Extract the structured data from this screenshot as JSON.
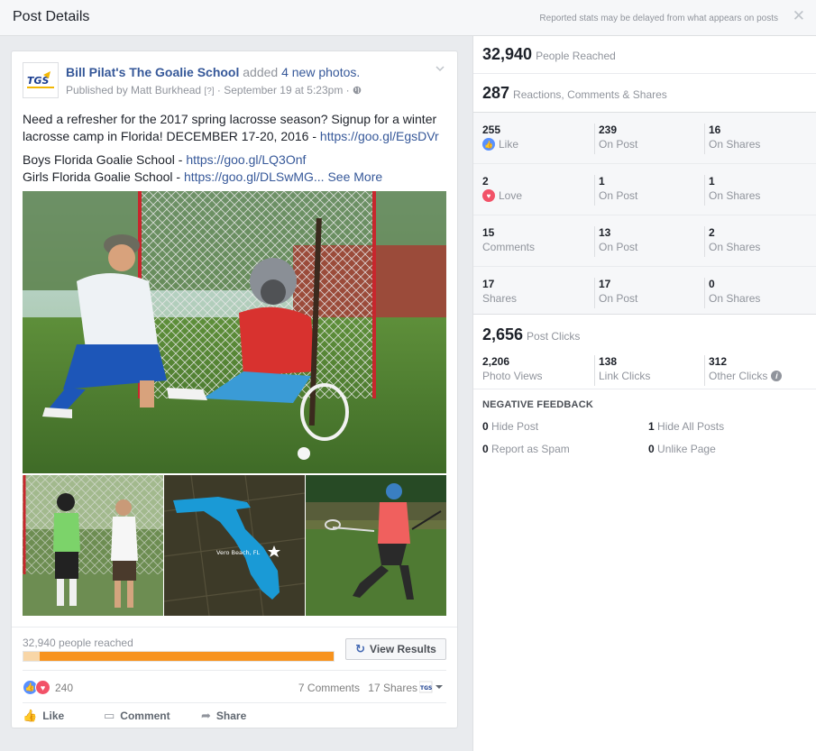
{
  "header": {
    "title": "Post Details",
    "note": "Reported stats may be delayed from what appears on posts",
    "close_icon": "close-icon"
  },
  "post": {
    "page_name": "Bill Pilat's The Goalie School",
    "action_text": "added",
    "photos_text": "4 new photos.",
    "published_by": "Published by Matt Burkhead",
    "help_mark": "[?]",
    "date": "· September 19 at 5:23pm ·",
    "text_line1": "Need a refresher for the 2017 spring lacrosse season? Signup for a winter lacrosse camp in Florida! DECEMBER 17-20, 2016 -",
    "link1": "https://goo.gl/EgsDVr",
    "boys_label": "Boys Florida Goalie School -",
    "boys_link": "https://goo.gl/LQ3Onf",
    "girls_label": "Girls Florida Goalie School -",
    "girls_link": "https://goo.gl/DLSwMG...",
    "see_more": "See More",
    "map_label": "Vero Beach, FL",
    "reach_label": "32,940 people reached",
    "view_results": "View Results",
    "reaction_count": "240",
    "comments": "7 Comments",
    "shares": "17 Shares",
    "like_action": "Like",
    "comment_action": "Comment",
    "share_action": "Share"
  },
  "stats": {
    "people_reached": "32,940",
    "people_reached_label": "People Reached",
    "engagement": "287",
    "engagement_label": "Reactions, Comments & Shares",
    "rows": [
      [
        {
          "num": "255",
          "label": "Like"
        },
        {
          "num": "239",
          "label": "On Post"
        },
        {
          "num": "16",
          "label": "On Shares"
        }
      ],
      [
        {
          "num": "2",
          "label": "Love"
        },
        {
          "num": "1",
          "label": "On Post"
        },
        {
          "num": "1",
          "label": "On Shares"
        }
      ],
      [
        {
          "num": "15",
          "label": "Comments"
        },
        {
          "num": "13",
          "label": "On Post"
        },
        {
          "num": "2",
          "label": "On Shares"
        }
      ],
      [
        {
          "num": "17",
          "label": "Shares"
        },
        {
          "num": "17",
          "label": "On Post"
        },
        {
          "num": "0",
          "label": "On Shares"
        }
      ]
    ],
    "post_clicks": "2,656",
    "post_clicks_label": "Post Clicks",
    "clicks": [
      {
        "num": "2,206",
        "label": "Photo Views"
      },
      {
        "num": "138",
        "label": "Link Clicks"
      },
      {
        "num": "312",
        "label": "Other Clicks"
      }
    ],
    "negative_title": "NEGATIVE FEEDBACK",
    "negative": [
      {
        "num": "0",
        "label": "Hide Post"
      },
      {
        "num": "1",
        "label": "Hide All Posts"
      },
      {
        "num": "0",
        "label": "Report as Spam"
      },
      {
        "num": "0",
        "label": "Unlike Page"
      }
    ]
  },
  "colors": {
    "link": "#365899",
    "reach_bar": "#f7931e",
    "like_blue": "#5890ff",
    "love_red": "#f25268"
  }
}
